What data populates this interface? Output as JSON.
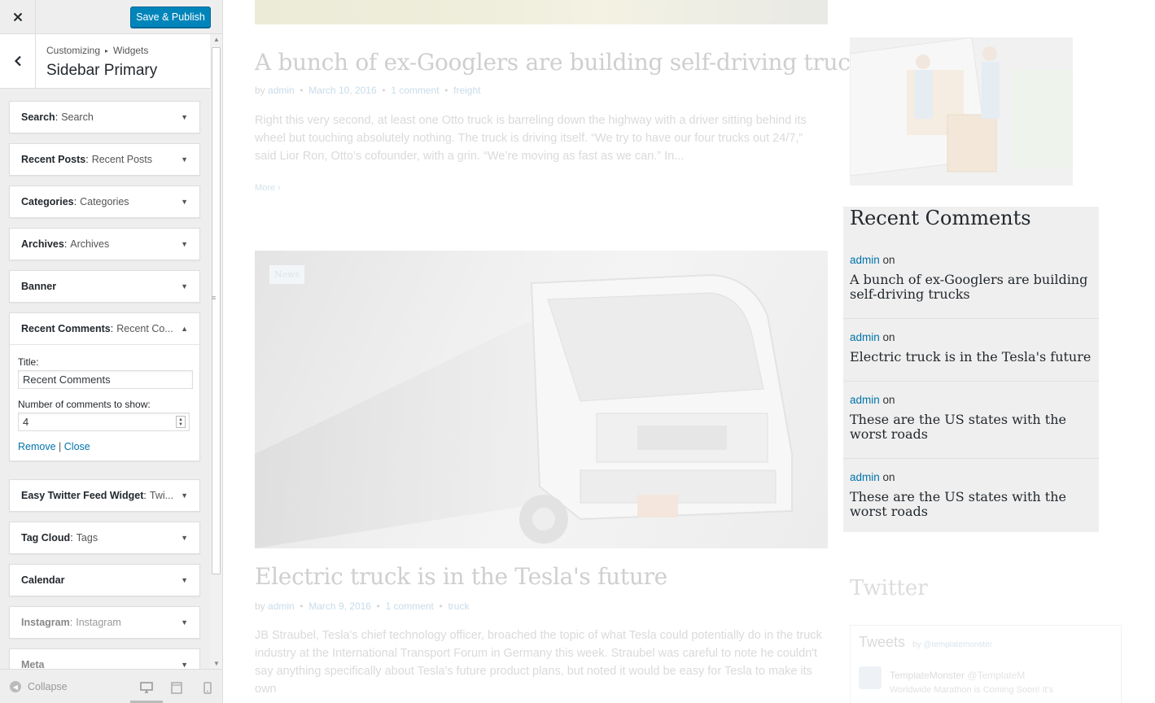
{
  "customizer": {
    "save_label": "Save & Publish",
    "breadcrumb": [
      "Customizing",
      "Widgets"
    ],
    "section_title": "Sidebar Primary",
    "widgets": [
      {
        "name": "Search",
        "sub": "Search"
      },
      {
        "name": "Recent Posts",
        "sub": "Recent Posts"
      },
      {
        "name": "Categories",
        "sub": "Categories"
      },
      {
        "name": "Archives",
        "sub": "Archives"
      },
      {
        "name": "Banner",
        "sub": ""
      },
      {
        "name": "Recent Comments",
        "sub": "Recent Co..."
      },
      {
        "name": "Easy Twitter Feed Widget",
        "sub": "Twi..."
      },
      {
        "name": "Tag Cloud",
        "sub": "Tags"
      },
      {
        "name": "Calendar",
        "sub": ""
      },
      {
        "name": "Instagram",
        "sub": "Instagram"
      },
      {
        "name": "Meta",
        "sub": ""
      }
    ],
    "expanded_form": {
      "title_label": "Title:",
      "title_value": "Recent Comments",
      "count_label": "Number of comments to show:",
      "count_value": "4",
      "remove_label": "Remove",
      "separator": "|",
      "close_label": "Close"
    },
    "collapse_label": "Collapse"
  },
  "preview": {
    "post1": {
      "title": "A bunch of ex-Googlers are building self-driving trucks",
      "by": "by",
      "author": "admin",
      "date": "March 10, 2016",
      "comments": "1 comment",
      "category": "freight",
      "excerpt": "Right this very second, at least one Otto truck is barreling down the highway with a driver sitting behind its wheel but touching absolutely nothing. The truck is driving itself. “We try to have our four trucks out 24/7,” said Lior Ron, Otto’s cofounder, with a grin. “We’re moving as fast as we can.” In...",
      "more": "More"
    },
    "post2": {
      "badge": "News",
      "title": "Electric truck is in the Tesla's future",
      "by": "by",
      "author": "admin",
      "date": "March 9, 2016",
      "comments": "1 comment",
      "category": "truck",
      "excerpt": "JB Straubel, Tesla's chief technology officer, broached the topic of what Tesla could potentially do in the truck industry at the International Transport Forum in Germany this week. Straubel was careful to note he couldn't say anything specifically about Tesla's future product plans, but noted it would be easy for Tesla to make its own"
    },
    "recent_comments": {
      "title": "Recent Comments",
      "on": "on",
      "items": [
        {
          "author": "admin",
          "post": "A bunch of ex-Googlers are building self-driving trucks"
        },
        {
          "author": "admin",
          "post": "Electric truck is in the Tesla's future"
        },
        {
          "author": "admin",
          "post": "These are the US states with the worst roads"
        },
        {
          "author": "admin",
          "post": "These are the US states with the worst roads"
        }
      ]
    },
    "twitter": {
      "title": "Twitter",
      "tweets_label": "Tweets",
      "by_label": "by",
      "handle": "@templatemonster",
      "account_name": "TemplateMonster",
      "account_handle": "@TemplateM",
      "tweet_text": "Worldwide Marathon is Coming Soon! It's"
    }
  },
  "colors": {
    "primary_button": "#0085ba",
    "link": "#0073aa",
    "sidebar_bg": "#eeeeee"
  }
}
